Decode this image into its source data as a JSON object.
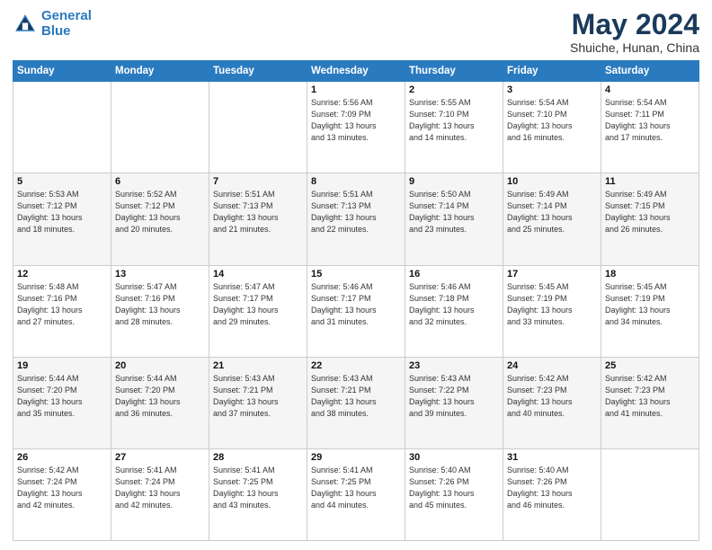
{
  "logo": {
    "line1": "General",
    "line2": "Blue"
  },
  "header": {
    "month_year": "May 2024",
    "location": "Shuiche, Hunan, China"
  },
  "weekdays": [
    "Sunday",
    "Monday",
    "Tuesday",
    "Wednesday",
    "Thursday",
    "Friday",
    "Saturday"
  ],
  "weeks": [
    [
      {
        "day": "",
        "info": ""
      },
      {
        "day": "",
        "info": ""
      },
      {
        "day": "",
        "info": ""
      },
      {
        "day": "1",
        "info": "Sunrise: 5:56 AM\nSunset: 7:09 PM\nDaylight: 13 hours\nand 13 minutes."
      },
      {
        "day": "2",
        "info": "Sunrise: 5:55 AM\nSunset: 7:10 PM\nDaylight: 13 hours\nand 14 minutes."
      },
      {
        "day": "3",
        "info": "Sunrise: 5:54 AM\nSunset: 7:10 PM\nDaylight: 13 hours\nand 16 minutes."
      },
      {
        "day": "4",
        "info": "Sunrise: 5:54 AM\nSunset: 7:11 PM\nDaylight: 13 hours\nand 17 minutes."
      }
    ],
    [
      {
        "day": "5",
        "info": "Sunrise: 5:53 AM\nSunset: 7:12 PM\nDaylight: 13 hours\nand 18 minutes."
      },
      {
        "day": "6",
        "info": "Sunrise: 5:52 AM\nSunset: 7:12 PM\nDaylight: 13 hours\nand 20 minutes."
      },
      {
        "day": "7",
        "info": "Sunrise: 5:51 AM\nSunset: 7:13 PM\nDaylight: 13 hours\nand 21 minutes."
      },
      {
        "day": "8",
        "info": "Sunrise: 5:51 AM\nSunset: 7:13 PM\nDaylight: 13 hours\nand 22 minutes."
      },
      {
        "day": "9",
        "info": "Sunrise: 5:50 AM\nSunset: 7:14 PM\nDaylight: 13 hours\nand 23 minutes."
      },
      {
        "day": "10",
        "info": "Sunrise: 5:49 AM\nSunset: 7:14 PM\nDaylight: 13 hours\nand 25 minutes."
      },
      {
        "day": "11",
        "info": "Sunrise: 5:49 AM\nSunset: 7:15 PM\nDaylight: 13 hours\nand 26 minutes."
      }
    ],
    [
      {
        "day": "12",
        "info": "Sunrise: 5:48 AM\nSunset: 7:16 PM\nDaylight: 13 hours\nand 27 minutes."
      },
      {
        "day": "13",
        "info": "Sunrise: 5:47 AM\nSunset: 7:16 PM\nDaylight: 13 hours\nand 28 minutes."
      },
      {
        "day": "14",
        "info": "Sunrise: 5:47 AM\nSunset: 7:17 PM\nDaylight: 13 hours\nand 29 minutes."
      },
      {
        "day": "15",
        "info": "Sunrise: 5:46 AM\nSunset: 7:17 PM\nDaylight: 13 hours\nand 31 minutes."
      },
      {
        "day": "16",
        "info": "Sunrise: 5:46 AM\nSunset: 7:18 PM\nDaylight: 13 hours\nand 32 minutes."
      },
      {
        "day": "17",
        "info": "Sunrise: 5:45 AM\nSunset: 7:19 PM\nDaylight: 13 hours\nand 33 minutes."
      },
      {
        "day": "18",
        "info": "Sunrise: 5:45 AM\nSunset: 7:19 PM\nDaylight: 13 hours\nand 34 minutes."
      }
    ],
    [
      {
        "day": "19",
        "info": "Sunrise: 5:44 AM\nSunset: 7:20 PM\nDaylight: 13 hours\nand 35 minutes."
      },
      {
        "day": "20",
        "info": "Sunrise: 5:44 AM\nSunset: 7:20 PM\nDaylight: 13 hours\nand 36 minutes."
      },
      {
        "day": "21",
        "info": "Sunrise: 5:43 AM\nSunset: 7:21 PM\nDaylight: 13 hours\nand 37 minutes."
      },
      {
        "day": "22",
        "info": "Sunrise: 5:43 AM\nSunset: 7:21 PM\nDaylight: 13 hours\nand 38 minutes."
      },
      {
        "day": "23",
        "info": "Sunrise: 5:43 AM\nSunset: 7:22 PM\nDaylight: 13 hours\nand 39 minutes."
      },
      {
        "day": "24",
        "info": "Sunrise: 5:42 AM\nSunset: 7:23 PM\nDaylight: 13 hours\nand 40 minutes."
      },
      {
        "day": "25",
        "info": "Sunrise: 5:42 AM\nSunset: 7:23 PM\nDaylight: 13 hours\nand 41 minutes."
      }
    ],
    [
      {
        "day": "26",
        "info": "Sunrise: 5:42 AM\nSunset: 7:24 PM\nDaylight: 13 hours\nand 42 minutes."
      },
      {
        "day": "27",
        "info": "Sunrise: 5:41 AM\nSunset: 7:24 PM\nDaylight: 13 hours\nand 42 minutes."
      },
      {
        "day": "28",
        "info": "Sunrise: 5:41 AM\nSunset: 7:25 PM\nDaylight: 13 hours\nand 43 minutes."
      },
      {
        "day": "29",
        "info": "Sunrise: 5:41 AM\nSunset: 7:25 PM\nDaylight: 13 hours\nand 44 minutes."
      },
      {
        "day": "30",
        "info": "Sunrise: 5:40 AM\nSunset: 7:26 PM\nDaylight: 13 hours\nand 45 minutes."
      },
      {
        "day": "31",
        "info": "Sunrise: 5:40 AM\nSunset: 7:26 PM\nDaylight: 13 hours\nand 46 minutes."
      },
      {
        "day": "",
        "info": ""
      }
    ]
  ]
}
